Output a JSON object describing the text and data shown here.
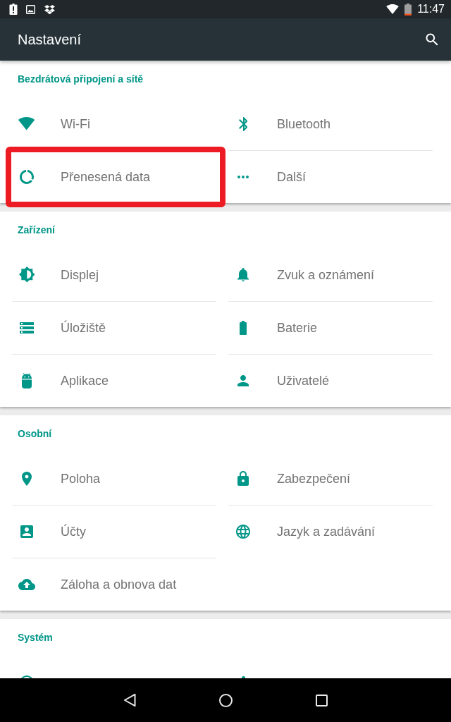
{
  "status_bar": {
    "time": "11:47"
  },
  "app_bar": {
    "title": "Nastavení"
  },
  "sections": [
    {
      "title": "Bezdrátová připojení a sítě",
      "items": [
        {
          "label": "Wi-Fi",
          "kind": "wifi",
          "highlighted": false
        },
        {
          "label": "Bluetooth",
          "kind": "bluetooth",
          "highlighted": false
        },
        {
          "label": "Přenesená data",
          "kind": "data",
          "highlighted": true
        },
        {
          "label": "Další",
          "kind": "more",
          "highlighted": false
        }
      ]
    },
    {
      "title": "Zařízení",
      "items": [
        {
          "label": "Displej",
          "kind": "brightness",
          "highlighted": false
        },
        {
          "label": "Zvuk a oznámení",
          "kind": "bell",
          "highlighted": false
        },
        {
          "label": "Úložiště",
          "kind": "storage",
          "highlighted": false
        },
        {
          "label": "Baterie",
          "kind": "battery",
          "highlighted": false
        },
        {
          "label": "Aplikace",
          "kind": "android",
          "highlighted": false
        },
        {
          "label": "Uživatelé",
          "kind": "person",
          "highlighted": false
        }
      ]
    },
    {
      "title": "Osobní",
      "items": [
        {
          "label": "Poloha",
          "kind": "place",
          "highlighted": false
        },
        {
          "label": "Zabezpečení",
          "kind": "lock",
          "highlighted": false
        },
        {
          "label": "Účty",
          "kind": "account",
          "highlighted": false
        },
        {
          "label": "Jazyk a zadávání",
          "kind": "globe",
          "highlighted": false
        },
        {
          "label": "Záloha a obnova dat",
          "kind": "cloud",
          "highlighted": false
        }
      ]
    },
    {
      "title": "Systém",
      "items": [
        {
          "kind": "ring",
          "highlighted": false
        },
        {
          "kind": "dot",
          "highlighted": false
        }
      ]
    }
  ]
}
